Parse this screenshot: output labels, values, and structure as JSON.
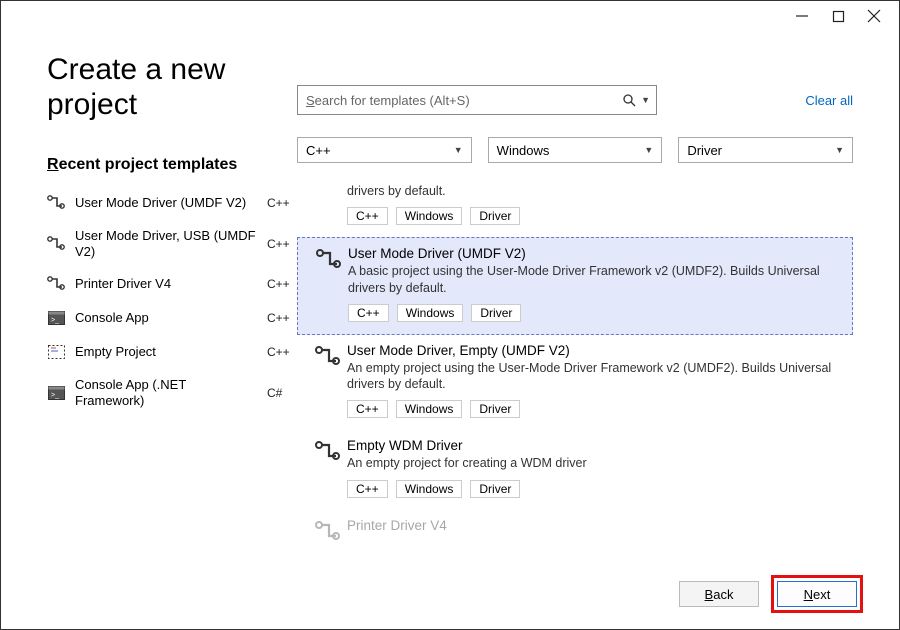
{
  "title_line1": "Create a new",
  "title_line2": "project",
  "recent_heading": "Recent project templates",
  "recent": [
    {
      "label": "User Mode Driver (UMDF V2)",
      "lang": "C++",
      "icon": "driver"
    },
    {
      "label": "User Mode Driver, USB (UMDF V2)",
      "lang": "C++",
      "icon": "driver"
    },
    {
      "label": "Printer Driver V4",
      "lang": "C++",
      "icon": "driver"
    },
    {
      "label": "Console App",
      "lang": "C++",
      "icon": "console"
    },
    {
      "label": "Empty Project",
      "lang": "C++",
      "icon": "empty"
    },
    {
      "label": "Console App (.NET Framework)",
      "lang": "C#",
      "icon": "console"
    }
  ],
  "search_placeholder": "Search for templates (Alt+S)",
  "clear_all": "Clear all",
  "filters": {
    "language": "C++",
    "platform": "Windows",
    "type": "Driver"
  },
  "tags": [
    "C++",
    "Windows",
    "Driver"
  ],
  "results": [
    {
      "title": "",
      "desc": "drivers by default.",
      "fragment": true
    },
    {
      "title": "User Mode Driver (UMDF V2)",
      "desc": "A basic project using the User-Mode Driver Framework v2 (UMDF2). Builds Universal drivers by default.",
      "selected": true
    },
    {
      "title": "User Mode Driver, Empty (UMDF V2)",
      "desc": "An empty project using the User-Mode Driver Framework v2 (UMDF2). Builds Universal drivers by default."
    },
    {
      "title": "Empty WDM Driver",
      "desc": "An empty project for creating a WDM driver"
    },
    {
      "title": "Printer Driver V4",
      "desc": "",
      "faded": true,
      "notags": true
    }
  ],
  "buttons": {
    "back": "Back",
    "next": "Next"
  }
}
